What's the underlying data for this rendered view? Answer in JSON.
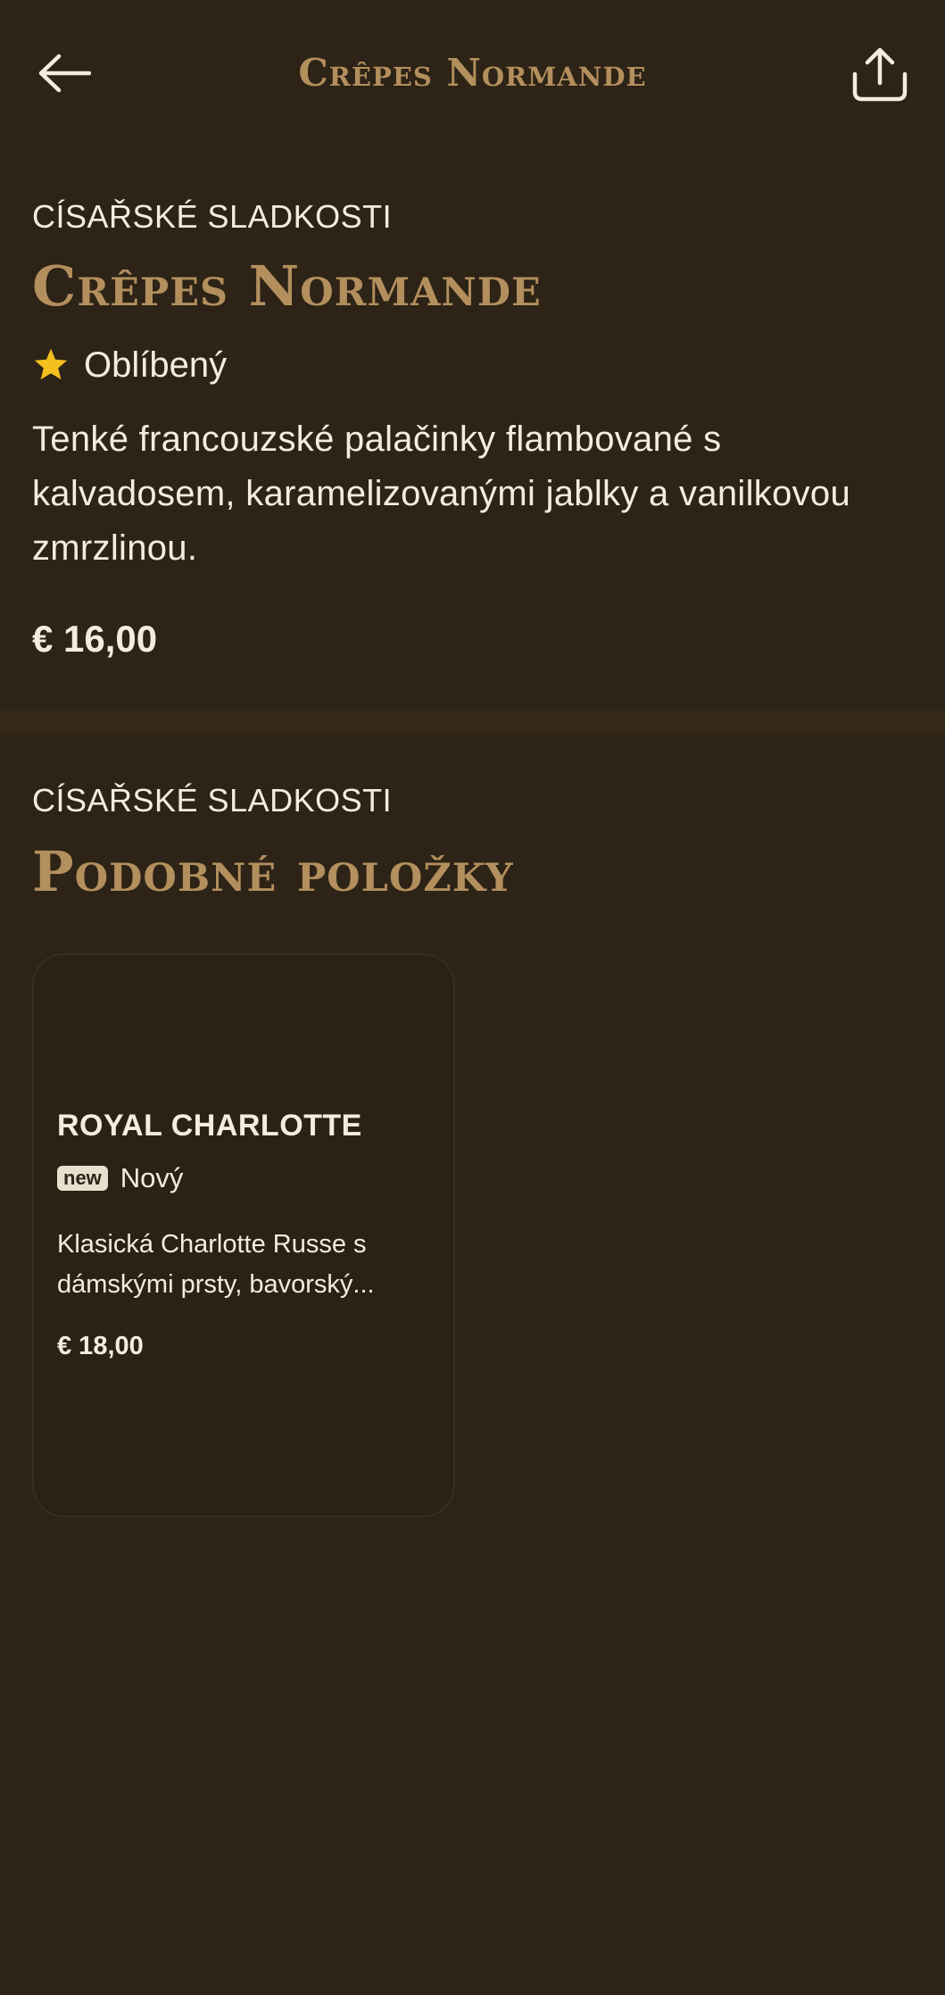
{
  "header": {
    "title": "Crêpes Normande",
    "back_icon": "arrow-left-icon",
    "share_icon": "share-icon"
  },
  "item": {
    "category": "CÍSAŘSKÉ SLADKOSTI",
    "title": "Crêpes Normande",
    "badge_icon": "star-icon",
    "badge_label": "Oblíbený",
    "description": "Tenké francouzské palačinky flambované s kalvadosem, karamelizovanými jablky a vanilkovou zmrzlinou.",
    "price": "€ 16,00"
  },
  "similar": {
    "category": "CÍSAŘSKÉ SLADKOSTI",
    "title": "Podobné položky",
    "items": [
      {
        "name": "ROYAL CHARLOTTE",
        "tag": "new",
        "badge_label": "Nový",
        "description_line1": "Klasická Charlotte Russe s",
        "description_line2": "dámskými prsty, bavorský...",
        "price": "€ 18,00"
      }
    ]
  },
  "colors": {
    "background": "#2d2316",
    "accent_gold": "#b38f5d",
    "text": "#f3ece0",
    "star": "#f5bf1f",
    "divider": "#342817"
  }
}
